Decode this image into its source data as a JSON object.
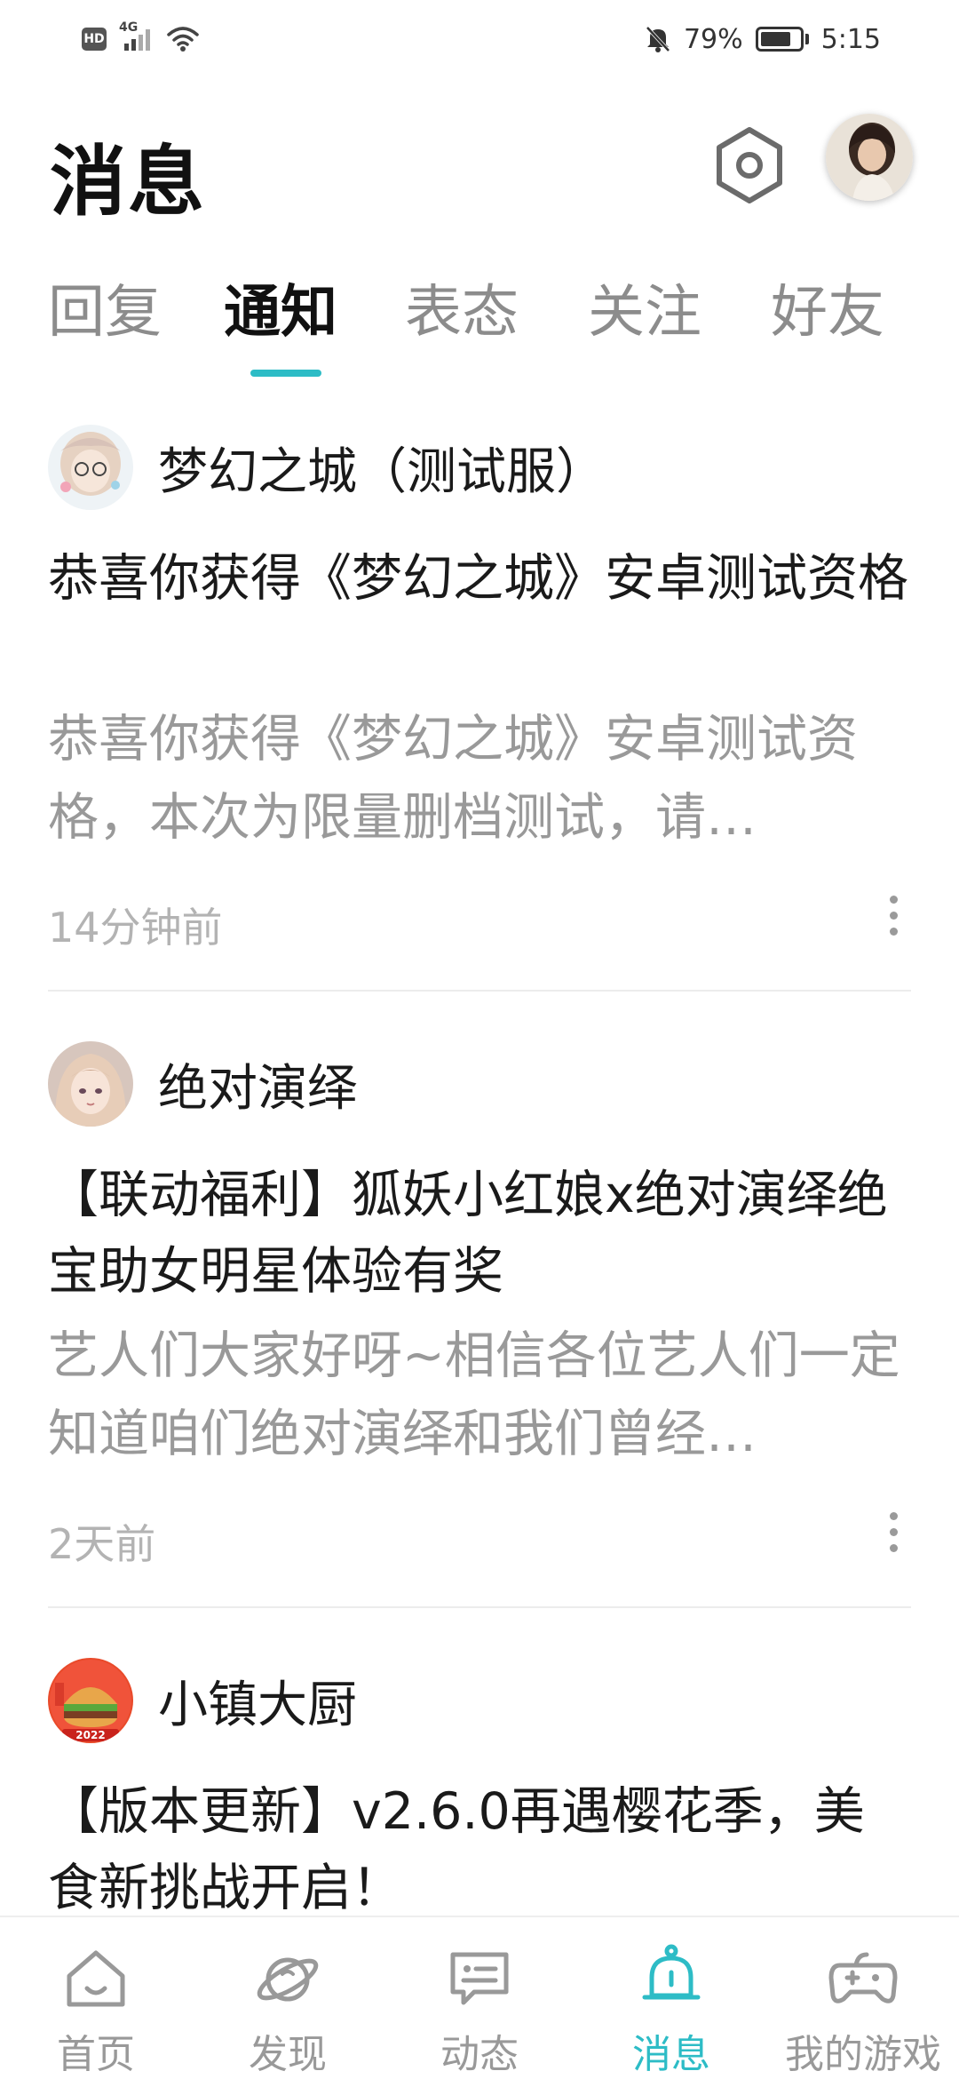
{
  "status_bar": {
    "hd": "HD",
    "network": "4G",
    "battery_percent": "79%",
    "battery_level": 0.79,
    "time": "5:15"
  },
  "header": {
    "title": "消息"
  },
  "tabs": [
    {
      "label": "回复"
    },
    {
      "label": "通知",
      "active": true
    },
    {
      "label": "表态"
    },
    {
      "label": "关注"
    },
    {
      "label": "好友"
    }
  ],
  "notifications": [
    {
      "sender": "梦幻之城（测试服）",
      "title": "恭喜你获得《梦幻之城》安卓测试资格",
      "preview": "恭喜你获得《梦幻之城》安卓测试资格，本次为限量删档测试，请…",
      "time": "14分钟前"
    },
    {
      "sender": "绝对演绎",
      "title": "【联动福利】狐妖小红娘x绝对演绎绝宝助女明星体验有奖",
      "preview": "艺人们大家好呀~相信各位艺人们一定知道咱们绝对演绎和我们曾经…",
      "time": "2天前"
    },
    {
      "sender": "小镇大厨",
      "title": "【版本更新】v2.6.0再遇樱花季，美食新挑战开启！",
      "badge_text": "2022"
    }
  ],
  "bottom_nav": [
    {
      "label": "首页",
      "icon": "home-icon"
    },
    {
      "label": "发现",
      "icon": "planet-icon"
    },
    {
      "label": "动态",
      "icon": "chat-icon"
    },
    {
      "label": "消息",
      "icon": "bell-icon",
      "active": true
    },
    {
      "label": "我的游戏",
      "icon": "gamepad-icon"
    }
  ],
  "colors": {
    "accent": "#2dbcc6",
    "text_primary": "#1a1a1a",
    "text_secondary": "#999999"
  }
}
